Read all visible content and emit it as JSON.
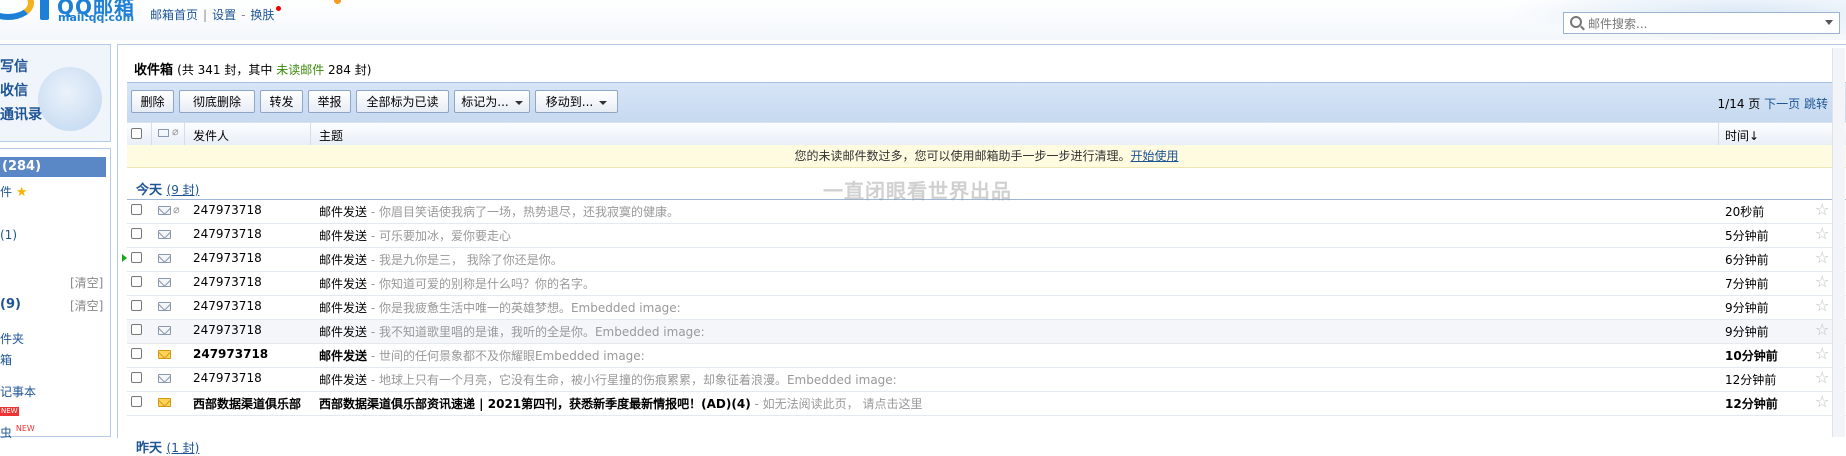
{
  "header": {
    "logo_title": "QQ邮箱",
    "logo_url": "mail.qq.com",
    "links": [
      "邮箱首页",
      "设置",
      "换肤"
    ],
    "search_placeholder": "邮件搜索..."
  },
  "sidebar": {
    "top_items": [
      "写信",
      "收信",
      "通讯录"
    ],
    "inbox_label": "(284)",
    "star_label": "件",
    "drafts_count": "(1)",
    "clear1": "[清空]",
    "spam_count": "(9)",
    "clear2": "[清空]",
    "folders_label": "件夹",
    "subscribe_label": "箱",
    "notes_label": "记事本",
    "new_badge": "NEW",
    "app_label": "虫",
    "new_text": "NEW"
  },
  "main": {
    "title": "收件箱",
    "count_prefix": "(共 341 封，其中 ",
    "unread_link": "未读邮件",
    "count_suffix": " 284 封)",
    "toolbar": {
      "delete": "删除",
      "perm_delete": "彻底删除",
      "forward": "转发",
      "report": "举报",
      "mark_all_read": "全部标为已读",
      "mark_as": "标记为...",
      "move_to": "移动到..."
    },
    "pager": {
      "page": "1/14 页",
      "next": "下一页",
      "jump": "跳转"
    },
    "columns": {
      "sender": "发件人",
      "subject": "主题",
      "time": "时间↓"
    },
    "notice_text": "您的未读邮件数过多，您可以使用邮箱助手一步一步进行清理。",
    "notice_link": "开始使用",
    "groups": {
      "today": "今天",
      "today_count": "(9 封)",
      "yesterday": "昨天",
      "yesterday_count": "(1 封)"
    },
    "watermark": "一直闭眼看世界出品",
    "emails": [
      {
        "from": "247973718",
        "subject": "邮件发送",
        "summary": " - 你眉目笑语使我病了一场，热势退尽，还我寂寞的健康。",
        "time": "20秒前",
        "unread": false,
        "attachment": true
      },
      {
        "from": "247973718",
        "subject": "邮件发送",
        "summary": " - 可乐要加冰，爱你要走心",
        "time": "5分钟前",
        "unread": false,
        "attachment": false
      },
      {
        "from": "247973718",
        "subject": "邮件发送",
        "summary": " - 我是九你是三，  我除了你还是你。",
        "time": "6分钟前",
        "unread": false,
        "attachment": false
      },
      {
        "from": "247973718",
        "subject": "邮件发送",
        "summary": " - 你知道可爱的别称是什么吗？你的名字。",
        "time": "7分钟前",
        "unread": false,
        "attachment": false
      },
      {
        "from": "247973718",
        "subject": "邮件发送",
        "summary": " - 你是我疲惫生活中唯一的英雄梦想。Embedded image:",
        "time": "9分钟前",
        "unread": false,
        "attachment": false
      },
      {
        "from": "247973718",
        "subject": "邮件发送",
        "summary": " - 我不知道歌里唱的是谁，我听的全是你。Embedded image:",
        "time": "9分钟前",
        "unread": false,
        "attachment": false
      },
      {
        "from": "247973718",
        "subject": "邮件发送",
        "summary": " - 世间的任何景象都不及你耀眼Embedded image:",
        "time": "10分钟前",
        "unread": true,
        "attachment": false
      },
      {
        "from": "247973718",
        "subject": "邮件发送",
        "summary": " - 地球上只有一个月亮，它没有生命，被小行星撞的伤痕累累，却象征着浪漫。Embedded image:",
        "time": "12分钟前",
        "unread": false,
        "attachment": false
      },
      {
        "from": "西部数据渠道俱乐部",
        "subject": "西部数据渠道俱乐部资讯速递 | 2021第四刊，获悉新季度最新情报吧！(AD)(4)",
        "summary": "  -  如无法阅读此页，  请点击这里",
        "time": "12分钟前",
        "unread": true,
        "attachment": false
      }
    ]
  }
}
